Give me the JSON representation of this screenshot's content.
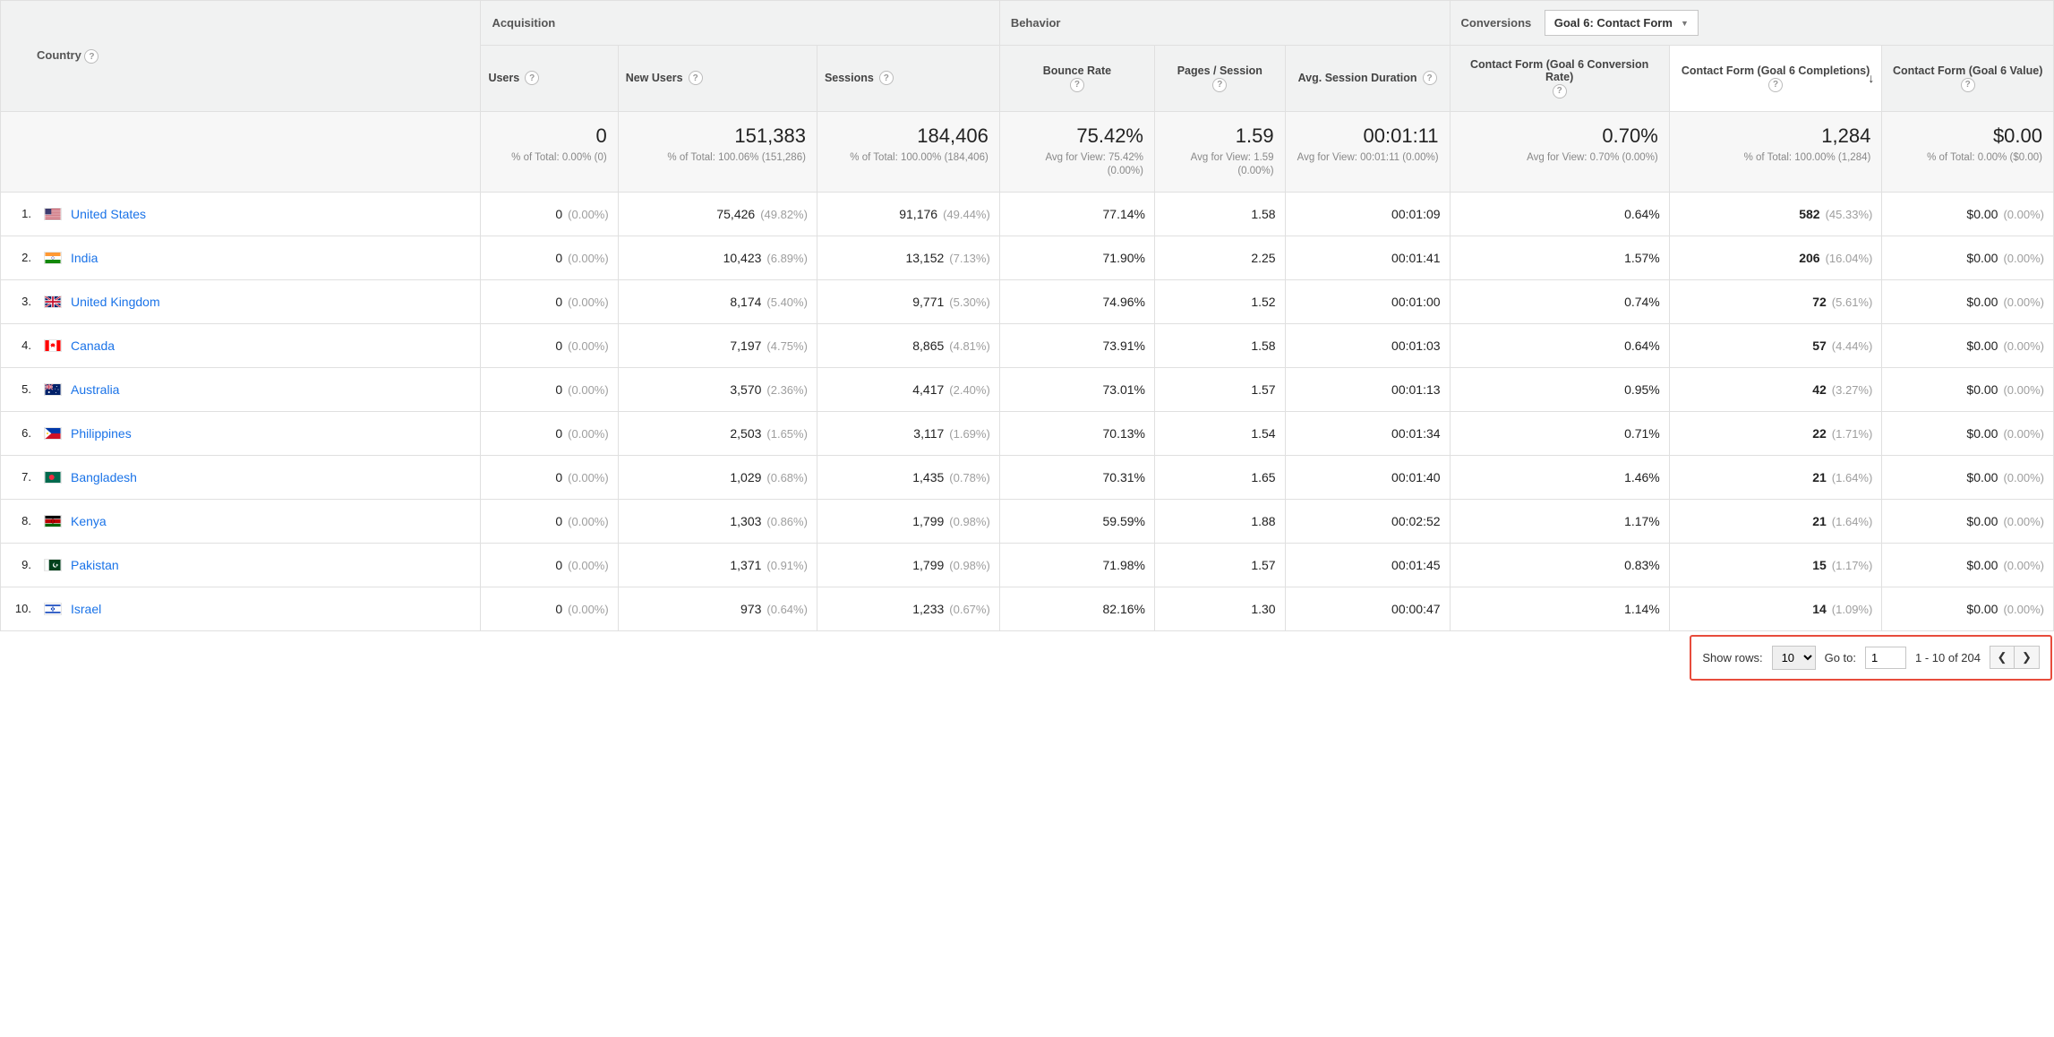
{
  "dimension": {
    "label": "Country"
  },
  "groups": {
    "acquisition": "Acquisition",
    "behavior": "Behavior",
    "conversions": "Conversions"
  },
  "goal_selector": {
    "value": "Goal 6: Contact Form"
  },
  "columns": {
    "users": "Users",
    "new_users": "New Users",
    "sessions": "Sessions",
    "bounce": "Bounce Rate",
    "pages": "Pages / Session",
    "duration": "Avg. Session Duration",
    "conv_rate": "Contact Form (Goal 6 Conversion Rate)",
    "completions": "Contact Form (Goal 6 Completions)",
    "value": "Contact Form (Goal 6 Value)"
  },
  "totals": {
    "users": {
      "big": "0",
      "sub": "% of Total: 0.00% (0)"
    },
    "new_users": {
      "big": "151,383",
      "sub": "% of Total: 100.06% (151,286)"
    },
    "sessions": {
      "big": "184,406",
      "sub": "% of Total: 100.00% (184,406)"
    },
    "bounce": {
      "big": "75.42%",
      "sub": "Avg for View: 75.42% (0.00%)"
    },
    "pages": {
      "big": "1.59",
      "sub": "Avg for View: 1.59 (0.00%)"
    },
    "duration": {
      "big": "00:01:11",
      "sub": "Avg for View: 00:01:11 (0.00%)"
    },
    "conv_rate": {
      "big": "0.70%",
      "sub": "Avg for View: 0.70% (0.00%)"
    },
    "completions": {
      "big": "1,284",
      "sub": "% of Total: 100.00% (1,284)"
    },
    "value": {
      "big": "$0.00",
      "sub": "% of Total: 0.00% ($0.00)"
    }
  },
  "rows": [
    {
      "idx": "1.",
      "flag": "us",
      "country": "United States",
      "users": "0",
      "users_pct": "(0.00%)",
      "new_users": "75,426",
      "new_users_pct": "(49.82%)",
      "sessions": "91,176",
      "sessions_pct": "(49.44%)",
      "bounce": "77.14%",
      "pages": "1.58",
      "duration": "00:01:09",
      "conv_rate": "0.64%",
      "completions": "582",
      "completions_pct": "(45.33%)",
      "value": "$0.00",
      "value_pct": "(0.00%)"
    },
    {
      "idx": "2.",
      "flag": "in",
      "country": "India",
      "users": "0",
      "users_pct": "(0.00%)",
      "new_users": "10,423",
      "new_users_pct": "(6.89%)",
      "sessions": "13,152",
      "sessions_pct": "(7.13%)",
      "bounce": "71.90%",
      "pages": "2.25",
      "duration": "00:01:41",
      "conv_rate": "1.57%",
      "completions": "206",
      "completions_pct": "(16.04%)",
      "value": "$0.00",
      "value_pct": "(0.00%)"
    },
    {
      "idx": "3.",
      "flag": "gb",
      "country": "United Kingdom",
      "users": "0",
      "users_pct": "(0.00%)",
      "new_users": "8,174",
      "new_users_pct": "(5.40%)",
      "sessions": "9,771",
      "sessions_pct": "(5.30%)",
      "bounce": "74.96%",
      "pages": "1.52",
      "duration": "00:01:00",
      "conv_rate": "0.74%",
      "completions": "72",
      "completions_pct": "(5.61%)",
      "value": "$0.00",
      "value_pct": "(0.00%)"
    },
    {
      "idx": "4.",
      "flag": "ca",
      "country": "Canada",
      "users": "0",
      "users_pct": "(0.00%)",
      "new_users": "7,197",
      "new_users_pct": "(4.75%)",
      "sessions": "8,865",
      "sessions_pct": "(4.81%)",
      "bounce": "73.91%",
      "pages": "1.58",
      "duration": "00:01:03",
      "conv_rate": "0.64%",
      "completions": "57",
      "completions_pct": "(4.44%)",
      "value": "$0.00",
      "value_pct": "(0.00%)"
    },
    {
      "idx": "5.",
      "flag": "au",
      "country": "Australia",
      "users": "0",
      "users_pct": "(0.00%)",
      "new_users": "3,570",
      "new_users_pct": "(2.36%)",
      "sessions": "4,417",
      "sessions_pct": "(2.40%)",
      "bounce": "73.01%",
      "pages": "1.57",
      "duration": "00:01:13",
      "conv_rate": "0.95%",
      "completions": "42",
      "completions_pct": "(3.27%)",
      "value": "$0.00",
      "value_pct": "(0.00%)"
    },
    {
      "idx": "6.",
      "flag": "ph",
      "country": "Philippines",
      "users": "0",
      "users_pct": "(0.00%)",
      "new_users": "2,503",
      "new_users_pct": "(1.65%)",
      "sessions": "3,117",
      "sessions_pct": "(1.69%)",
      "bounce": "70.13%",
      "pages": "1.54",
      "duration": "00:01:34",
      "conv_rate": "0.71%",
      "completions": "22",
      "completions_pct": "(1.71%)",
      "value": "$0.00",
      "value_pct": "(0.00%)"
    },
    {
      "idx": "7.",
      "flag": "bd",
      "country": "Bangladesh",
      "users": "0",
      "users_pct": "(0.00%)",
      "new_users": "1,029",
      "new_users_pct": "(0.68%)",
      "sessions": "1,435",
      "sessions_pct": "(0.78%)",
      "bounce": "70.31%",
      "pages": "1.65",
      "duration": "00:01:40",
      "conv_rate": "1.46%",
      "completions": "21",
      "completions_pct": "(1.64%)",
      "value": "$0.00",
      "value_pct": "(0.00%)"
    },
    {
      "idx": "8.",
      "flag": "ke",
      "country": "Kenya",
      "users": "0",
      "users_pct": "(0.00%)",
      "new_users": "1,303",
      "new_users_pct": "(0.86%)",
      "sessions": "1,799",
      "sessions_pct": "(0.98%)",
      "bounce": "59.59%",
      "pages": "1.88",
      "duration": "00:02:52",
      "conv_rate": "1.17%",
      "completions": "21",
      "completions_pct": "(1.64%)",
      "value": "$0.00",
      "value_pct": "(0.00%)"
    },
    {
      "idx": "9.",
      "flag": "pk",
      "country": "Pakistan",
      "users": "0",
      "users_pct": "(0.00%)",
      "new_users": "1,371",
      "new_users_pct": "(0.91%)",
      "sessions": "1,799",
      "sessions_pct": "(0.98%)",
      "bounce": "71.98%",
      "pages": "1.57",
      "duration": "00:01:45",
      "conv_rate": "0.83%",
      "completions": "15",
      "completions_pct": "(1.17%)",
      "value": "$0.00",
      "value_pct": "(0.00%)"
    },
    {
      "idx": "10.",
      "flag": "il",
      "country": "Israel",
      "users": "0",
      "users_pct": "(0.00%)",
      "new_users": "973",
      "new_users_pct": "(0.64%)",
      "sessions": "1,233",
      "sessions_pct": "(0.67%)",
      "bounce": "82.16%",
      "pages": "1.30",
      "duration": "00:00:47",
      "conv_rate": "1.14%",
      "completions": "14",
      "completions_pct": "(1.09%)",
      "value": "$0.00",
      "value_pct": "(0.00%)"
    }
  ],
  "pager": {
    "show_rows_label": "Show rows:",
    "show_rows_value": "10",
    "go_to_label": "Go to:",
    "go_to_value": "1",
    "range": "1 - 10 of 204"
  }
}
